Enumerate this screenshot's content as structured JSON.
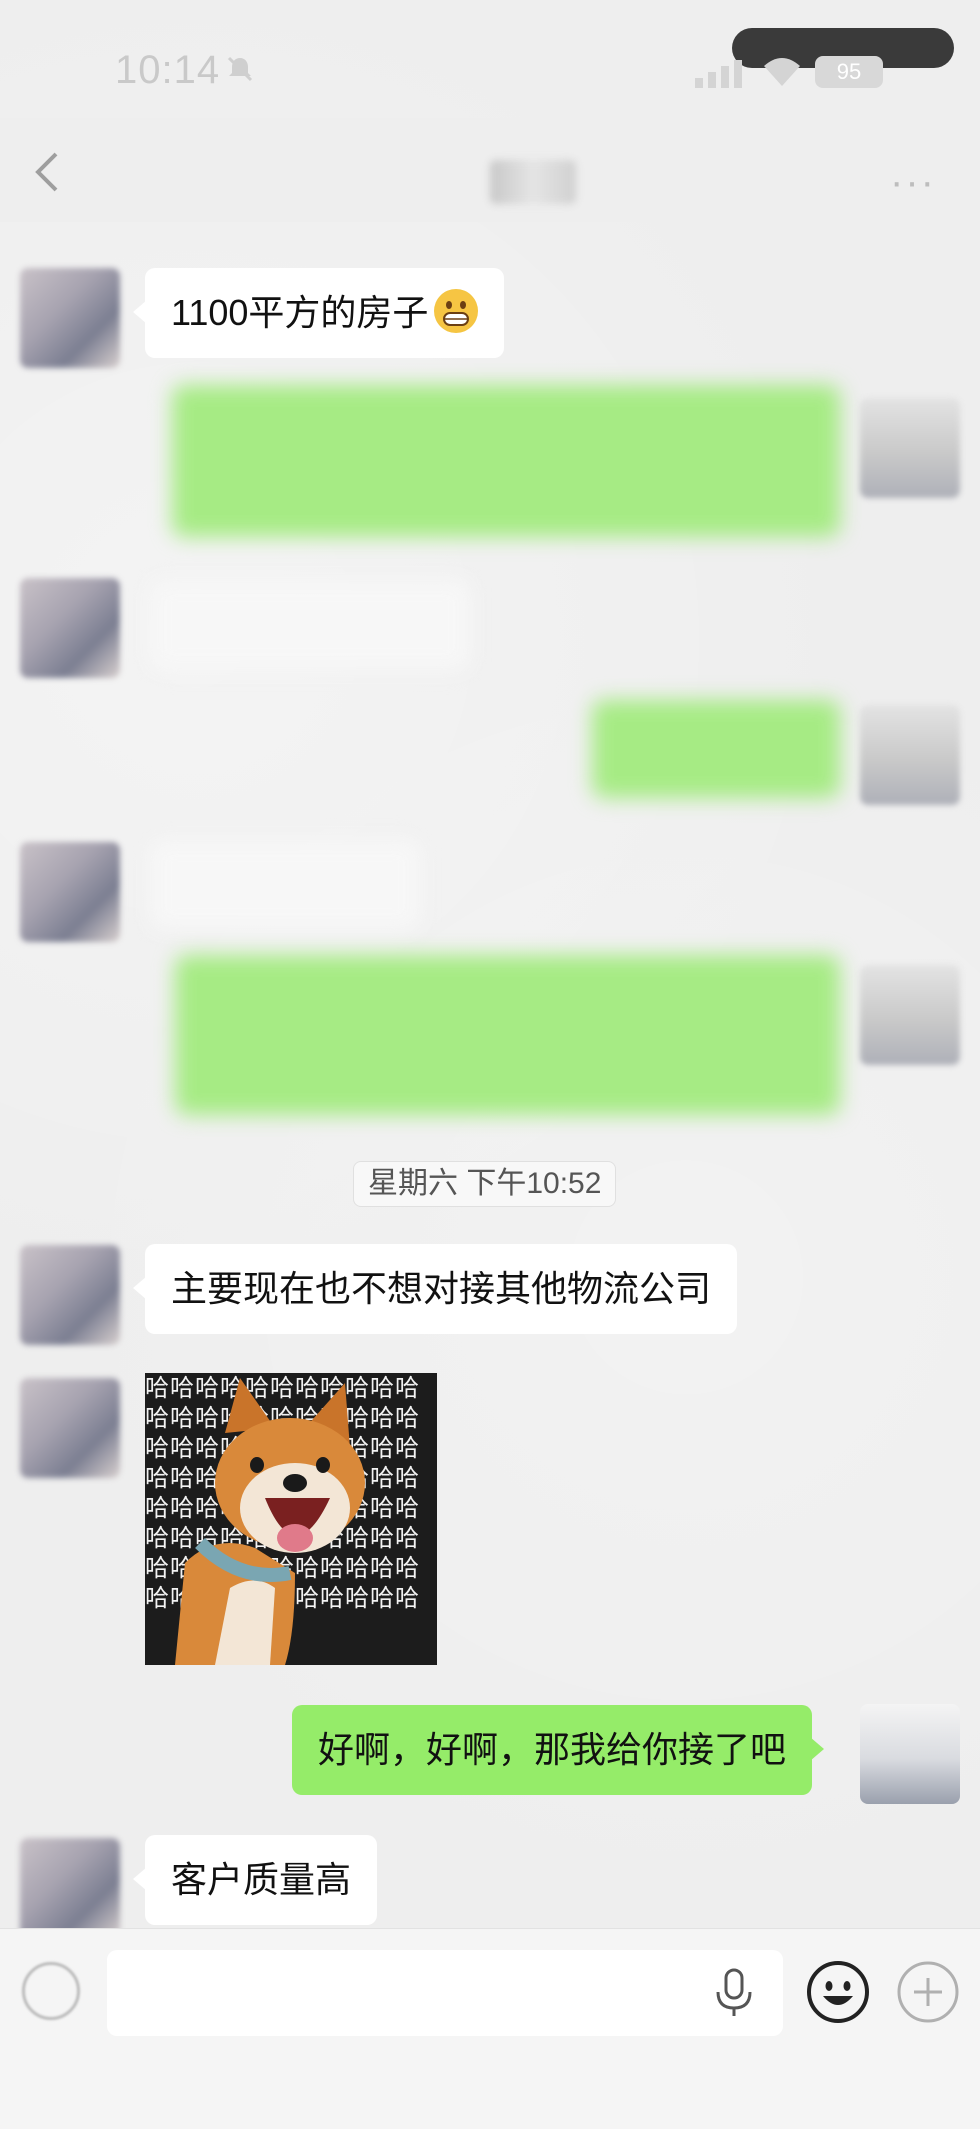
{
  "status_bar": {
    "time": "10:14",
    "battery": "95"
  },
  "nav": {
    "back_icon": "chevron-left-icon",
    "more_icon": "ellipsis-icon",
    "more_label": "···"
  },
  "messages": [
    {
      "side": "left",
      "text": "1100平方的房子",
      "emoji": "grinning-face"
    },
    {
      "side": "right",
      "text": "",
      "blurred": true
    },
    {
      "side": "left",
      "text": "",
      "blurred": true
    },
    {
      "side": "right",
      "text": "",
      "blurred": true
    },
    {
      "side": "left",
      "text": "",
      "blurred": true
    },
    {
      "side": "right",
      "text": "",
      "blurred": true
    },
    {
      "type": "timestamp",
      "text": "星期六 下午10:52"
    },
    {
      "side": "left",
      "text": "主要现在也不想对接其他物流公司"
    },
    {
      "side": "left",
      "type": "sticker",
      "sticker_text": "哈哈哈哈哈哈哈哈哈哈哈哈哈哈哈哈哈哈哈哈哈哈哈哈哈哈哈哈哈哈哈哈哈哈哈哈哈哈哈哈哈哈哈哈哈哈哈哈哈哈哈哈哈哈哈哈哈哈哈哈哈哈哈哈哈哈哈哈哈哈哈哈哈哈哈哈哈哈哈哈哈哈哈哈哈哈哈哈"
    },
    {
      "side": "right",
      "text": "好啊，好啊，那我给你接了吧"
    },
    {
      "side": "left",
      "text": "客户质量高"
    }
  ],
  "input": {
    "value": "",
    "placeholder": ""
  },
  "colors": {
    "sent_bubble": "#95ec69",
    "received_bubble": "#ffffff",
    "background": "#ededed"
  }
}
